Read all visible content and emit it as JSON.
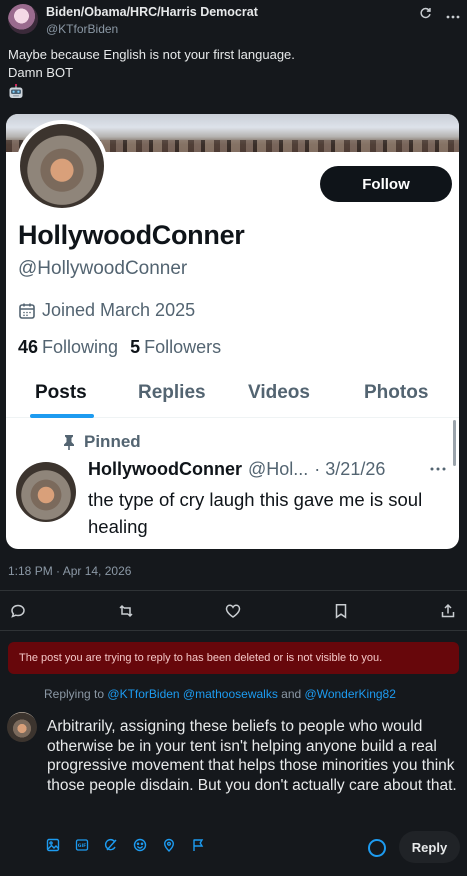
{
  "post": {
    "author_name": "Biden/Obama/HRC/Harris Democrat",
    "author_handle": "@KTforBiden",
    "text_line1": "Maybe because English is not your first language.",
    "text_line2": "Damn BOT",
    "emoji": "robot-face",
    "timestamp": "1:18 PM · Apr 14, 2026"
  },
  "embed": {
    "profile_name": "HollywoodConner",
    "profile_handle": "@HollywoodConner",
    "follow_label": "Follow",
    "joined": "Joined March 2025",
    "following_count": "46",
    "following_label": "Following",
    "followers_count": "5",
    "followers_label": "Followers",
    "tabs": [
      "Posts",
      "Replies",
      "Videos",
      "Photos"
    ],
    "pinned_label": "Pinned",
    "tweet_name": "HollywoodConner",
    "tweet_handle": "@Hol...",
    "tweet_date": "· 3/21/26",
    "tweet_text": "the type of cry laugh this gave me is soul healing"
  },
  "error_message": "The post you are trying to reply to has been deleted or is not visible to you.",
  "replying": {
    "prefix": "Replying to",
    "users": "@KTforBiden @mathoosewalks",
    "conjunction": "and",
    "last_user": "@WonderKing82"
  },
  "reply": {
    "text": "Arbitrarily, assigning these beliefs to people who would otherwise be in your tent isn't helping anyone build a real progressive movement that helps those minorities you think those people disdain. But you don't actually care about that.",
    "button_label": "Reply"
  },
  "colors": {
    "accent": "#1d9bf0",
    "error_bg": "#67070b",
    "background": "#15181c"
  }
}
